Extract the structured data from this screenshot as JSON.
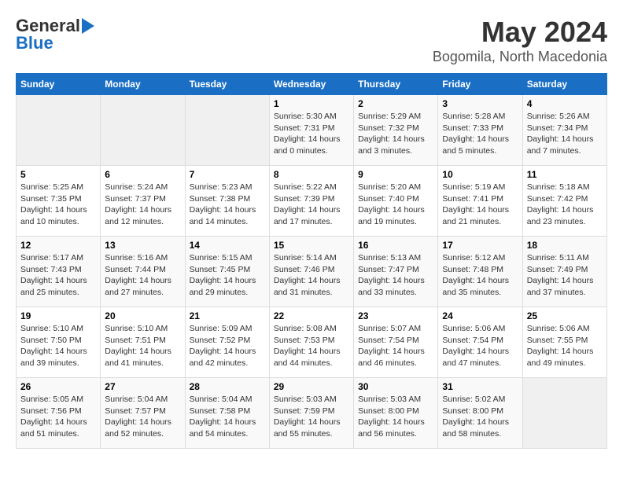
{
  "logo": {
    "text_general": "General",
    "text_blue": "Blue"
  },
  "title": "May 2024",
  "subtitle": "Bogomila, North Macedonia",
  "days_of_week": [
    "Sunday",
    "Monday",
    "Tuesday",
    "Wednesday",
    "Thursday",
    "Friday",
    "Saturday"
  ],
  "weeks": [
    [
      {
        "day": "",
        "info": ""
      },
      {
        "day": "",
        "info": ""
      },
      {
        "day": "",
        "info": ""
      },
      {
        "day": "1",
        "info": "Sunrise: 5:30 AM\nSunset: 7:31 PM\nDaylight: 14 hours\nand 0 minutes."
      },
      {
        "day": "2",
        "info": "Sunrise: 5:29 AM\nSunset: 7:32 PM\nDaylight: 14 hours\nand 3 minutes."
      },
      {
        "day": "3",
        "info": "Sunrise: 5:28 AM\nSunset: 7:33 PM\nDaylight: 14 hours\nand 5 minutes."
      },
      {
        "day": "4",
        "info": "Sunrise: 5:26 AM\nSunset: 7:34 PM\nDaylight: 14 hours\nand 7 minutes."
      }
    ],
    [
      {
        "day": "5",
        "info": "Sunrise: 5:25 AM\nSunset: 7:35 PM\nDaylight: 14 hours\nand 10 minutes."
      },
      {
        "day": "6",
        "info": "Sunrise: 5:24 AM\nSunset: 7:37 PM\nDaylight: 14 hours\nand 12 minutes."
      },
      {
        "day": "7",
        "info": "Sunrise: 5:23 AM\nSunset: 7:38 PM\nDaylight: 14 hours\nand 14 minutes."
      },
      {
        "day": "8",
        "info": "Sunrise: 5:22 AM\nSunset: 7:39 PM\nDaylight: 14 hours\nand 17 minutes."
      },
      {
        "day": "9",
        "info": "Sunrise: 5:20 AM\nSunset: 7:40 PM\nDaylight: 14 hours\nand 19 minutes."
      },
      {
        "day": "10",
        "info": "Sunrise: 5:19 AM\nSunset: 7:41 PM\nDaylight: 14 hours\nand 21 minutes."
      },
      {
        "day": "11",
        "info": "Sunrise: 5:18 AM\nSunset: 7:42 PM\nDaylight: 14 hours\nand 23 minutes."
      }
    ],
    [
      {
        "day": "12",
        "info": "Sunrise: 5:17 AM\nSunset: 7:43 PM\nDaylight: 14 hours\nand 25 minutes."
      },
      {
        "day": "13",
        "info": "Sunrise: 5:16 AM\nSunset: 7:44 PM\nDaylight: 14 hours\nand 27 minutes."
      },
      {
        "day": "14",
        "info": "Sunrise: 5:15 AM\nSunset: 7:45 PM\nDaylight: 14 hours\nand 29 minutes."
      },
      {
        "day": "15",
        "info": "Sunrise: 5:14 AM\nSunset: 7:46 PM\nDaylight: 14 hours\nand 31 minutes."
      },
      {
        "day": "16",
        "info": "Sunrise: 5:13 AM\nSunset: 7:47 PM\nDaylight: 14 hours\nand 33 minutes."
      },
      {
        "day": "17",
        "info": "Sunrise: 5:12 AM\nSunset: 7:48 PM\nDaylight: 14 hours\nand 35 minutes."
      },
      {
        "day": "18",
        "info": "Sunrise: 5:11 AM\nSunset: 7:49 PM\nDaylight: 14 hours\nand 37 minutes."
      }
    ],
    [
      {
        "day": "19",
        "info": "Sunrise: 5:10 AM\nSunset: 7:50 PM\nDaylight: 14 hours\nand 39 minutes."
      },
      {
        "day": "20",
        "info": "Sunrise: 5:10 AM\nSunset: 7:51 PM\nDaylight: 14 hours\nand 41 minutes."
      },
      {
        "day": "21",
        "info": "Sunrise: 5:09 AM\nSunset: 7:52 PM\nDaylight: 14 hours\nand 42 minutes."
      },
      {
        "day": "22",
        "info": "Sunrise: 5:08 AM\nSunset: 7:53 PM\nDaylight: 14 hours\nand 44 minutes."
      },
      {
        "day": "23",
        "info": "Sunrise: 5:07 AM\nSunset: 7:54 PM\nDaylight: 14 hours\nand 46 minutes."
      },
      {
        "day": "24",
        "info": "Sunrise: 5:06 AM\nSunset: 7:54 PM\nDaylight: 14 hours\nand 47 minutes."
      },
      {
        "day": "25",
        "info": "Sunrise: 5:06 AM\nSunset: 7:55 PM\nDaylight: 14 hours\nand 49 minutes."
      }
    ],
    [
      {
        "day": "26",
        "info": "Sunrise: 5:05 AM\nSunset: 7:56 PM\nDaylight: 14 hours\nand 51 minutes."
      },
      {
        "day": "27",
        "info": "Sunrise: 5:04 AM\nSunset: 7:57 PM\nDaylight: 14 hours\nand 52 minutes."
      },
      {
        "day": "28",
        "info": "Sunrise: 5:04 AM\nSunset: 7:58 PM\nDaylight: 14 hours\nand 54 minutes."
      },
      {
        "day": "29",
        "info": "Sunrise: 5:03 AM\nSunset: 7:59 PM\nDaylight: 14 hours\nand 55 minutes."
      },
      {
        "day": "30",
        "info": "Sunrise: 5:03 AM\nSunset: 8:00 PM\nDaylight: 14 hours\nand 56 minutes."
      },
      {
        "day": "31",
        "info": "Sunrise: 5:02 AM\nSunset: 8:00 PM\nDaylight: 14 hours\nand 58 minutes."
      },
      {
        "day": "",
        "info": ""
      }
    ]
  ]
}
